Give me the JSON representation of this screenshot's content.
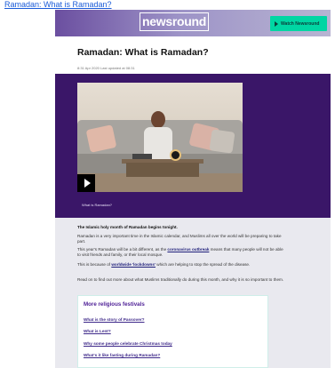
{
  "top_link": "Ramadan: What is Ramadan?",
  "header": {
    "logo": "newsround",
    "watch_button": "Watch Newsround"
  },
  "article_header": {
    "title": "Ramadan: What is Ramadan?",
    "meta": "8:31 Apr 2020  Last updated at 08:31"
  },
  "video": {
    "caption": "What is Ramadan?"
  },
  "article": {
    "lead": "The Islamic holy month of Ramadan begins tonight.",
    "p1": "Ramadan is a very important time in the Islamic calendar, and Muslims all over the world will be preparing to take part.",
    "p2_pre": "This year's Ramadan will be a bit different, as the ",
    "p2_link": "coronavirus outbreak",
    "p2_post": " means that many people will not be able to visit friends and family, or their local mosque.",
    "p3_pre": "This is because of ",
    "p3_link": "worldwide 'lockdowns'",
    "p3_post": " which are helping to stop the spread of the disease.",
    "p4": "Read on to find out more about what Muslims traditionally do during this month, and why it is so important to them."
  },
  "related": {
    "title": "More religious festivals",
    "links": [
      "What is the story of Passover?",
      "What is Lent?",
      "Why some people celebrate Christmas today",
      "What's it like fasting during Ramadan?"
    ]
  }
}
